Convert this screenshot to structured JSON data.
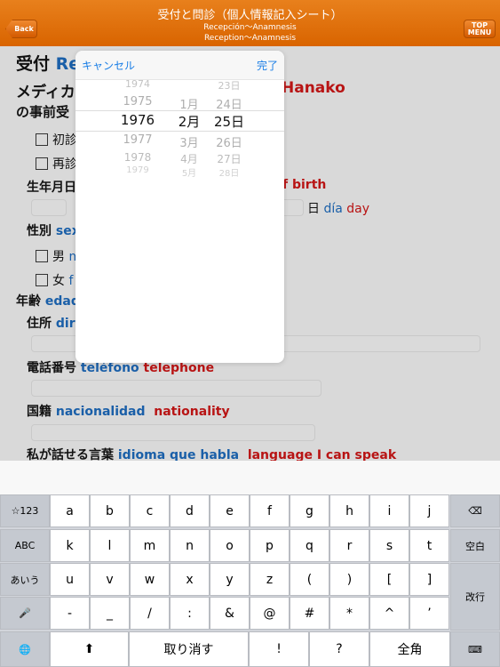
{
  "header": {
    "title": "受付と問診（個人情報記入シート）",
    "subtitle_es": "Recepción〜Anamnesis",
    "subtitle_en": "Reception〜Anamnesis",
    "back": "Back",
    "top_menu": "TOP MENU"
  },
  "form": {
    "heading_jp": "受付",
    "heading_es": "Re",
    "line2_jp": "メディカ",
    "line2_en": "Hanako",
    "line3_jp": "の事前受",
    "first_visit": "初診",
    "revisit": "再診",
    "dob_jp": "生年月日",
    "dob_en": "f birth",
    "day_jp": "日",
    "day_es": "día",
    "day_en": "day",
    "sex_jp": "性別",
    "sex_es": "sex",
    "male_jp": "男",
    "male_es": "m",
    "female_jp": "女",
    "female_es": "f",
    "age_jp": "年齢",
    "age_es": "edad",
    "address_jp": "住所",
    "address_es": "dir",
    "phone_jp": "電話番号",
    "phone_es": "teléfono",
    "phone_en": "telephone",
    "nation_jp": "国籍",
    "nation_es": "nacionalidad",
    "nation_en": "nationality",
    "lang_jp": "私が話せる言葉",
    "lang_es": "idioma que habla",
    "lang_en": "language I can speak"
  },
  "picker": {
    "cancel": "キャンセル",
    "done": "完了",
    "years": [
      "1974",
      "1975",
      "1976",
      "1977",
      "1978",
      "1979"
    ],
    "months": [
      "",
      "1月",
      "2月",
      "3月",
      "4月",
      "5月"
    ],
    "days": [
      "23日",
      "24日",
      "25日",
      "26日",
      "27日",
      "28日"
    ],
    "selected": {
      "year": "1976",
      "month": "2月",
      "day": "25日"
    }
  },
  "keyboard": {
    "row1": [
      "a",
      "b",
      "c",
      "d",
      "e",
      "f",
      "g",
      "h",
      "i",
      "j"
    ],
    "row2": [
      "k",
      "l",
      "m",
      "n",
      "o",
      "p",
      "q",
      "r",
      "s",
      "t"
    ],
    "row3": [
      "u",
      "v",
      "w",
      "x",
      "y",
      "z",
      "(",
      ")",
      "[",
      "]"
    ],
    "row4": [
      "-",
      "_",
      "/",
      ":",
      "&",
      "@",
      "#",
      "*",
      "^",
      "’"
    ],
    "sym": "☆123",
    "abc": "ABC",
    "kana": "あいう",
    "space": "空白",
    "enter": "改行",
    "undo": "取り消す",
    "excl": "!",
    "quest": "?",
    "zenkaku": "全角",
    "icons": [
      "backspace-icon",
      "microphone-icon",
      "globe-icon",
      "shift-icon",
      "keyboard-hide-icon"
    ]
  }
}
